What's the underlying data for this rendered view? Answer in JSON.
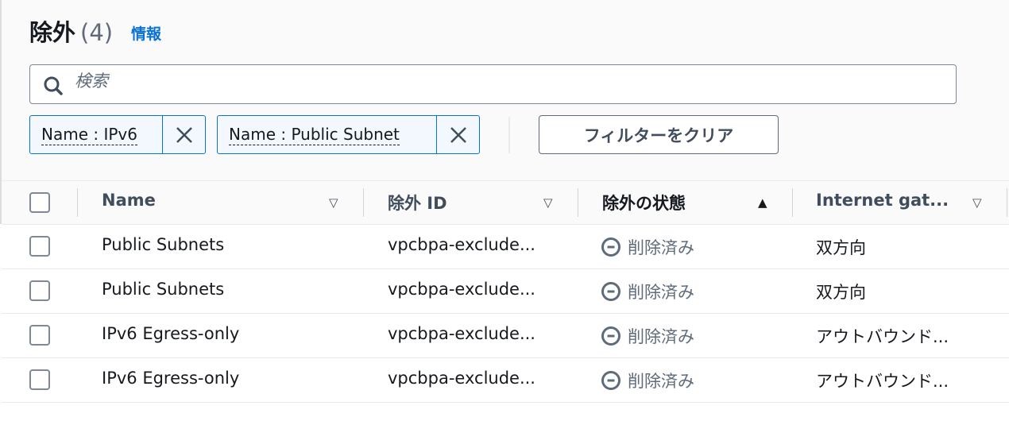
{
  "header": {
    "title": "除外",
    "count": "(4)",
    "info_link": "情報"
  },
  "search": {
    "placeholder": "検索",
    "value": ""
  },
  "filters": [
    {
      "label": "Name : IPv6"
    },
    {
      "label": "Name : Public Subnet"
    }
  ],
  "clear_filters_label": "フィルターをクリア",
  "columns": [
    {
      "label": "Name",
      "sort": "▽"
    },
    {
      "label": "除外 ID",
      "sort": "▽"
    },
    {
      "label": "除外の状態",
      "sort": "▲"
    },
    {
      "label": "Internet gat...",
      "sort": "▽"
    }
  ],
  "rows": [
    {
      "name": "Public Subnets",
      "id": "vpcbpa-exclude...",
      "status": "削除済み",
      "gateway": "双方向"
    },
    {
      "name": "Public Subnets",
      "id": "vpcbpa-exclude...",
      "status": "削除済み",
      "gateway": "双方向"
    },
    {
      "name": "IPv6 Egress-only",
      "id": "vpcbpa-exclude...",
      "status": "削除済み",
      "gateway": "アウトバウンド..."
    },
    {
      "name": "IPv6 Egress-only",
      "id": "vpcbpa-exclude...",
      "status": "削除済み",
      "gateway": "アウトバウンド..."
    }
  ],
  "colors": {
    "link": "#0972d3",
    "token_bg": "#f2f8fd",
    "status": "#5f6b7a"
  }
}
